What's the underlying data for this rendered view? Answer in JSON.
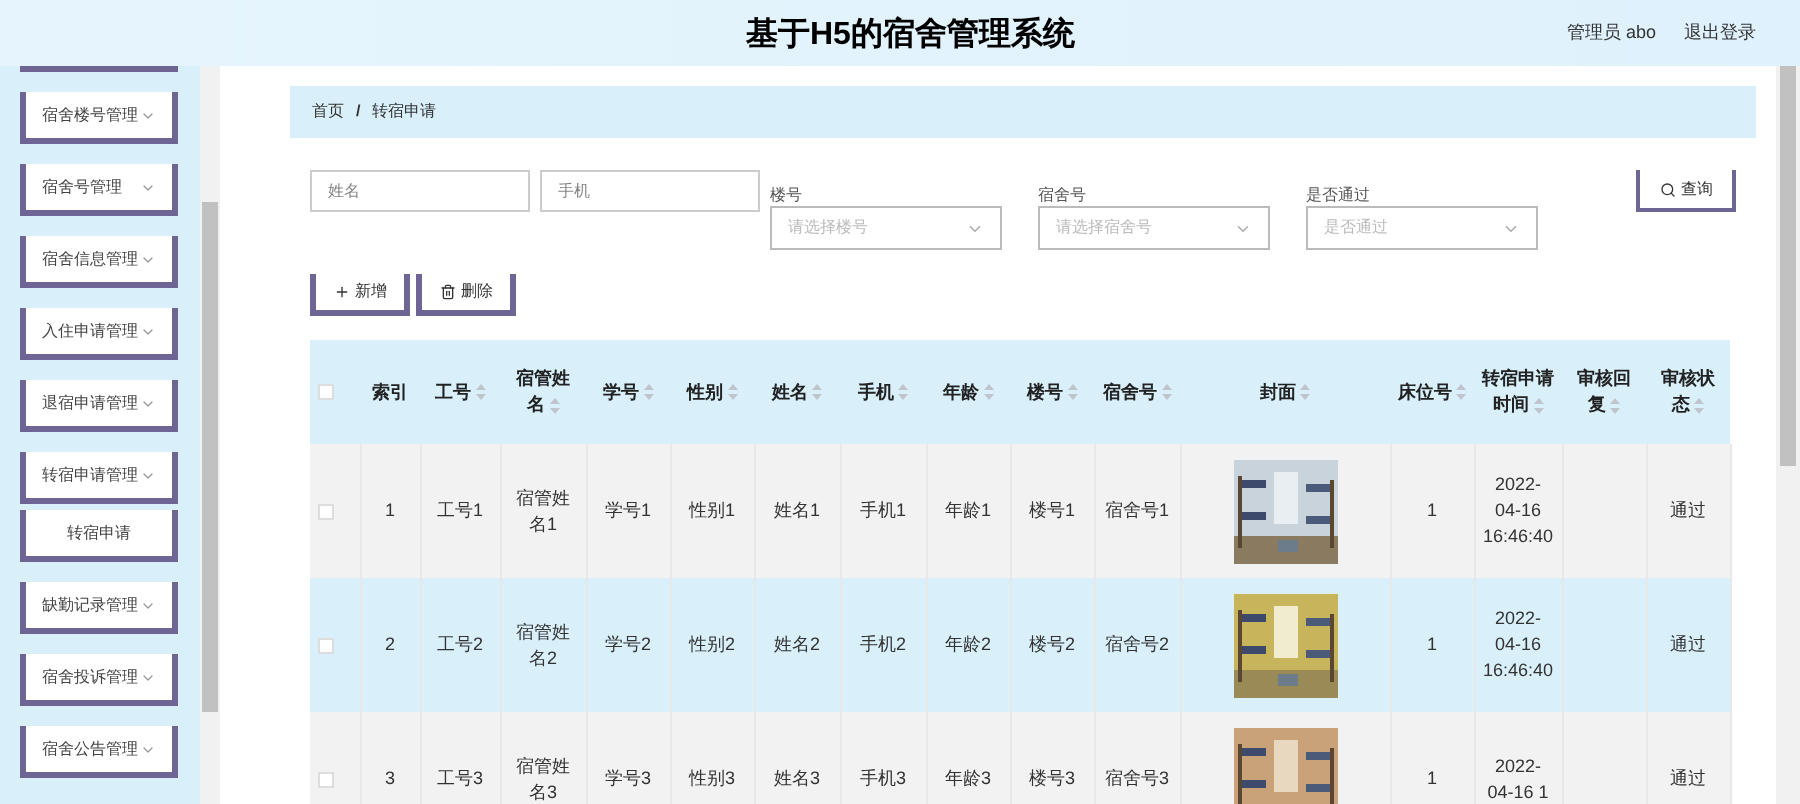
{
  "header": {
    "title": "基于H5的宿舍管理系统",
    "user": "管理员 abo",
    "logout": "退出登录"
  },
  "sidebar": {
    "items": [
      {
        "label": "宿舍楼号管理",
        "kind": "group"
      },
      {
        "label": "宿舍号管理",
        "kind": "group"
      },
      {
        "label": "宿舍信息管理",
        "kind": "group"
      },
      {
        "label": "入住申请管理",
        "kind": "group"
      },
      {
        "label": "退宿申请管理",
        "kind": "group"
      },
      {
        "label": "转宿申请管理",
        "kind": "group"
      },
      {
        "label": "转宿申请",
        "kind": "sub"
      },
      {
        "label": "缺勤记录管理",
        "kind": "group"
      },
      {
        "label": "宿舍投诉管理",
        "kind": "group"
      },
      {
        "label": "宿舍公告管理",
        "kind": "group"
      }
    ]
  },
  "breadcrumb": [
    "首页",
    "转宿申请"
  ],
  "breadcrumb_separator": "/",
  "filters": {
    "name": {
      "placeholder": "姓名"
    },
    "phone": {
      "placeholder": "手机"
    },
    "selects": [
      {
        "label": "楼号",
        "placeholder": "请选择楼号"
      },
      {
        "label": "宿舍号",
        "placeholder": "请选择宿舍号"
      },
      {
        "label": "是否通过",
        "placeholder": "是否通过"
      }
    ],
    "search_button": "查询"
  },
  "actions": [
    {
      "label": "新增",
      "kind": "add"
    },
    {
      "label": "删除",
      "kind": "delete"
    }
  ],
  "table": {
    "select_all_checked": false,
    "columns": [
      {
        "label": "索引",
        "sortable": false
      },
      {
        "label": "工号",
        "sortable": true
      },
      {
        "label": "宿管姓名",
        "sortable": true
      },
      {
        "label": "学号",
        "sortable": true
      },
      {
        "label": "性别",
        "sortable": true
      },
      {
        "label": "姓名",
        "sortable": true
      },
      {
        "label": "手机",
        "sortable": true
      },
      {
        "label": "年龄",
        "sortable": true
      },
      {
        "label": "楼号",
        "sortable": true
      },
      {
        "label": "宿舍号",
        "sortable": true
      },
      {
        "label": "封面",
        "sortable": true
      },
      {
        "label": "床位号",
        "sortable": true
      },
      {
        "label": "转宿申请时间",
        "sortable": true
      },
      {
        "label": "审核回复",
        "sortable": true
      },
      {
        "label": "审核状态",
        "sortable": true
      }
    ],
    "rows": [
      {
        "selected": false,
        "checked": false,
        "cells": [
          "1",
          "工号1",
          "宿管姓名1",
          "学号1",
          "性别1",
          "姓名1",
          "手机1",
          "年龄1",
          "楼号1",
          "宿舍号1",
          null,
          "1",
          "2022-04-16 16:46:40",
          "",
          "通过"
        ]
      },
      {
        "selected": true,
        "checked": false,
        "cells": [
          "2",
          "工号2",
          "宿管姓名2",
          "学号2",
          "性别2",
          "姓名2",
          "手机2",
          "年龄2",
          "楼号2",
          "宿舍号2",
          null,
          "1",
          "2022-04-16 16:46:40",
          "",
          "通过"
        ]
      },
      {
        "selected": false,
        "checked": false,
        "cells": [
          "3",
          "工号3",
          "宿管姓名3",
          "学号3",
          "性别3",
          "姓名3",
          "手机3",
          "年龄3",
          "楼号3",
          "宿舍号3",
          null,
          "1",
          "2022-04-16 1",
          "",
          "通过"
        ]
      }
    ]
  }
}
